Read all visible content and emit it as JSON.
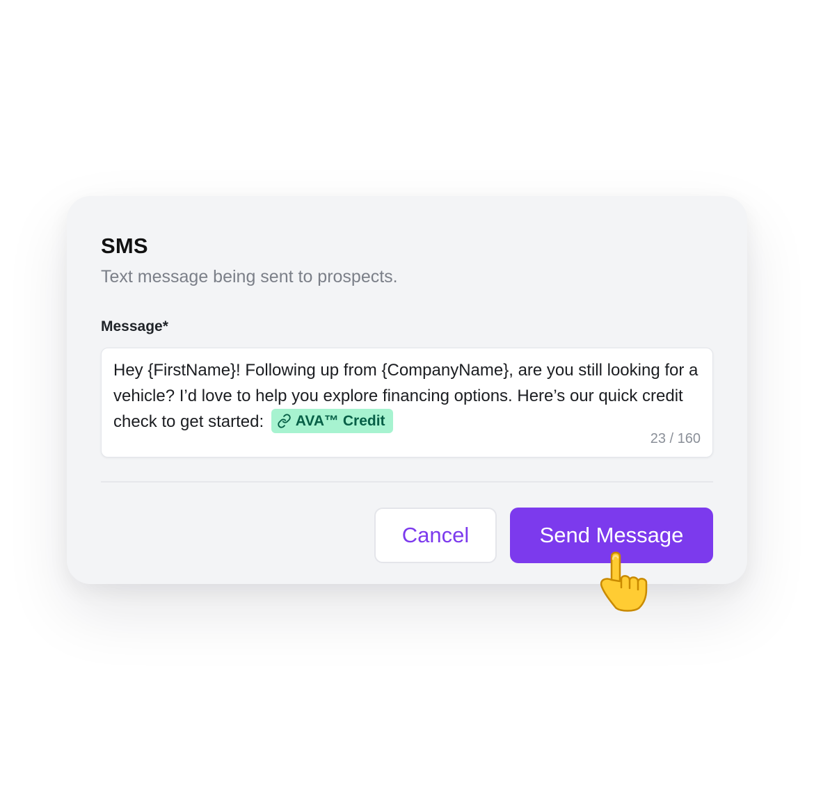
{
  "dialog": {
    "title": "SMS",
    "subtitle": "Text message being sent to prospects.",
    "message_label": "Message*",
    "message_text": "Hey {FirstName}! Following up from {CompanyName}, are you still looking for a vehicle? I’d love to help you explore financing options. Here’s our quick credit check to get started:",
    "link_chip": {
      "label": "AVA™ Credit",
      "icon": "link-icon"
    },
    "char_counter": "23 / 160",
    "cancel_label": "Cancel",
    "send_label": "Send Message"
  },
  "pointer": {
    "icon": "pointing-hand-icon"
  },
  "colors": {
    "accent": "#7c3aed",
    "card_bg": "#f3f4f6",
    "chip_bg": "#a7f3d0",
    "chip_text": "#065f46",
    "subtitle": "#7b7f88"
  }
}
